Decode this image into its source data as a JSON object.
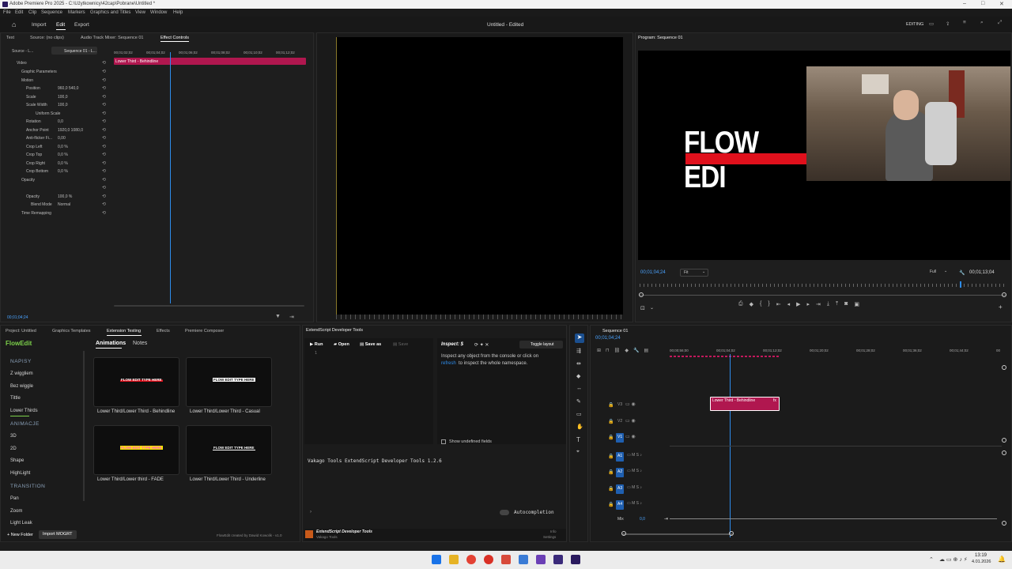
{
  "window": {
    "title": "Adobe Premiere Pro 2025 - C:\\Użytkownicy\\42cap\\Pobrane\\Untitled *"
  },
  "menu": [
    "File",
    "Edit",
    "Clip",
    "Sequence",
    "Markers",
    "Graphics and Titles",
    "View",
    "Window",
    "Help"
  ],
  "header": {
    "tabs": [
      "Import",
      "Edit",
      "Export"
    ],
    "active": "Edit",
    "doc_title": "Untitled - Edited",
    "workspace": "EDITING"
  },
  "effect_controls": {
    "tabs": [
      "Text",
      "Source: (no clips)",
      "Audio Track Mixer: Sequence 01",
      "Effect Controls"
    ],
    "source_tab": "Source - L...",
    "seq_tab": "Sequence 01 - L...",
    "timecodes": [
      "00;01;02;02",
      "00;01;04;02",
      "00;01;06;02",
      "00;01;08;02",
      "00;01;10;02",
      "00;01;12;02"
    ],
    "clip_label": "Lower Third - Behindline",
    "rows": [
      {
        "label": "Video",
        "value": ""
      },
      {
        "label": "Graphic Parameters",
        "value": ""
      },
      {
        "label": "Motion",
        "value": ""
      },
      {
        "label": "Position",
        "value": "960,0    540,0"
      },
      {
        "label": "Scale",
        "value": "100,0"
      },
      {
        "label": "Scale Width",
        "value": "100,0"
      },
      {
        "label": "Uniform Scale",
        "value": ""
      },
      {
        "label": "Rotation",
        "value": "0,0"
      },
      {
        "label": "Anchor Point",
        "value": "1920,0    1080,0"
      },
      {
        "label": "Anti-flicker Fi...",
        "value": "0,00"
      },
      {
        "label": "Crop Left",
        "value": "0,0 %"
      },
      {
        "label": "Crop Top",
        "value": "0,0 %"
      },
      {
        "label": "Crop Right",
        "value": "0,0 %"
      },
      {
        "label": "Crop Bottom",
        "value": "0,0 %"
      },
      {
        "label": "Opacity",
        "value": ""
      },
      {
        "label": "",
        "value": ""
      },
      {
        "label": "Opacity",
        "value": "100,0 %"
      },
      {
        "label": "Blend Mode",
        "value": "Normal"
      },
      {
        "label": "Time Remapping",
        "value": ""
      }
    ],
    "current_time": "00;01;04;24"
  },
  "program": {
    "tab": "Program: Sequence 01",
    "title_text": "FLOW EDI",
    "timecode": "00;01;04;24",
    "fit": "Fit",
    "quality": "Full",
    "duration": "00;01;13;04"
  },
  "bottom_tabs": [
    "Project: Untitled",
    "Graphics Templates",
    "Extension Testing",
    "Effects",
    "Premiere Composer"
  ],
  "flowedit": {
    "brand": "FlowEdit",
    "tabs": [
      "Animations",
      "Notes"
    ],
    "sections": [
      {
        "title": "NAPISY",
        "items": [
          "Z wiggliem",
          "Bez wiggle",
          "Tittle",
          "Lower Thirds"
        ]
      },
      {
        "title": "ANIMACJE",
        "items": [
          "3D",
          "2D",
          "Shape",
          "HighLight"
        ]
      },
      {
        "title": "TRANSITION",
        "items": [
          "Pan",
          "Zoom",
          "Light Leak"
        ]
      }
    ],
    "thumbs": [
      {
        "caption": "Lower Third/Lower Third - Behindline",
        "preview": "FLOW EDIT TYPE HERE"
      },
      {
        "caption": "Lower Third/Lower Third - Casual",
        "preview": "FLOW EDIT TYPE HERE"
      },
      {
        "caption": "Lower Third/Lower third - FADE",
        "preview": "FLOW EDIT TYPE HERE"
      },
      {
        "caption": "Lower Third/Lower Third - Underline",
        "preview": "FLOW EDIT TYPE HERE"
      }
    ],
    "new_folder": "+ New Folder",
    "import": "Import MOGRT",
    "credit": "FlowEdit created by Dawid Kowolik - v1.0"
  },
  "devtools": {
    "tab": "ExtendScript Developer Tools",
    "run": "Run",
    "open": "Open",
    "save": "Save as",
    "save2": "Save",
    "line": "1",
    "inspect": "Inspect: $",
    "toggle": "Toggle layout",
    "inspect_help": "Inspect any object from the console or click on",
    "refresh": "refresh",
    "inspect_help2": "to inspect the whole namespace.",
    "undefined": "Show undefined fields",
    "console": "Vakago Tools ExtendScript Developer Tools 1.2.6",
    "autocompletion": "Autocompletion",
    "footer_title": "ExtendScript Developer Tools",
    "footer_sub": "Vakago Tools",
    "info": "Info",
    "settings": "Settings"
  },
  "timeline": {
    "tab": "Sequence 01",
    "timecode": "00;01;04;24",
    "ruler": [
      "00;00;56;00",
      "00;01;04;02",
      "00;01;12;02",
      "00;01;20;02",
      "00;01;28;02",
      "00;01;36;02",
      "00;01;44;02",
      "00"
    ],
    "clip": "Lower Third - Behindline",
    "video_tracks": [
      "V3",
      "V2",
      "V1"
    ],
    "audio_tracks": [
      "A1",
      "A2",
      "A3",
      "A4"
    ],
    "mix": "Mix",
    "mix_val": "0,0"
  },
  "taskbar": {
    "time": "13:19",
    "date": "4.01.2026"
  },
  "colors": {
    "accent": "#2d8ceb",
    "clip": "#c2185b",
    "brand_green": "#7cd14a"
  }
}
